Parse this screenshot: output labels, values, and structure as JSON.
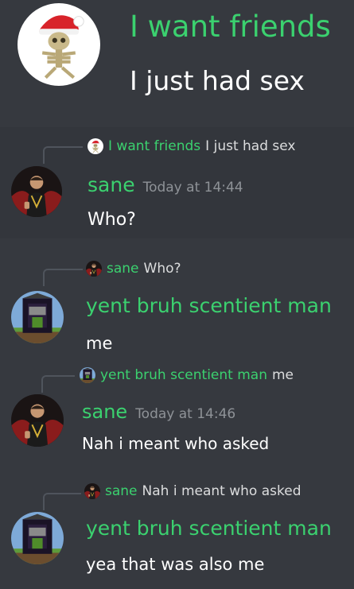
{
  "colors": {
    "background": "#36393f",
    "username": "#3bd16f",
    "text": "#ffffff",
    "timestamp": "#8e9297"
  },
  "messages": [
    {
      "author": "I want friends",
      "text": "I just had sex",
      "avatar_icon": "skeleton-santa-hat-avatar"
    },
    {
      "reply_to": {
        "author": "I want friends",
        "text": "I just had sex",
        "avatar_icon": "skeleton-santa-hat-avatar"
      },
      "author": "sane",
      "timestamp": "Today at 14:44",
      "text": "Who?",
      "avatar_icon": "man-in-chair-avatar"
    },
    {
      "reply_to": {
        "author": "sane",
        "text": "Who?",
        "avatar_icon": "man-in-chair-avatar"
      },
      "author": "yent bruh scentient man",
      "text": "me",
      "avatar_icon": "minecraft-portal-avatar"
    },
    {
      "reply_to": {
        "author": "yent bruh scentient man",
        "text": "me",
        "avatar_icon": "minecraft-portal-avatar"
      },
      "author": "sane",
      "timestamp": "Today at 14:46",
      "text": "Nah i meant who asked",
      "avatar_icon": "man-in-chair-avatar"
    },
    {
      "reply_to": {
        "author": "sane",
        "text": "Nah i meant who asked",
        "avatar_icon": "man-in-chair-avatar"
      },
      "author": "yent bruh scentient man",
      "text": "yea that was also me",
      "avatar_icon": "minecraft-portal-avatar"
    }
  ]
}
